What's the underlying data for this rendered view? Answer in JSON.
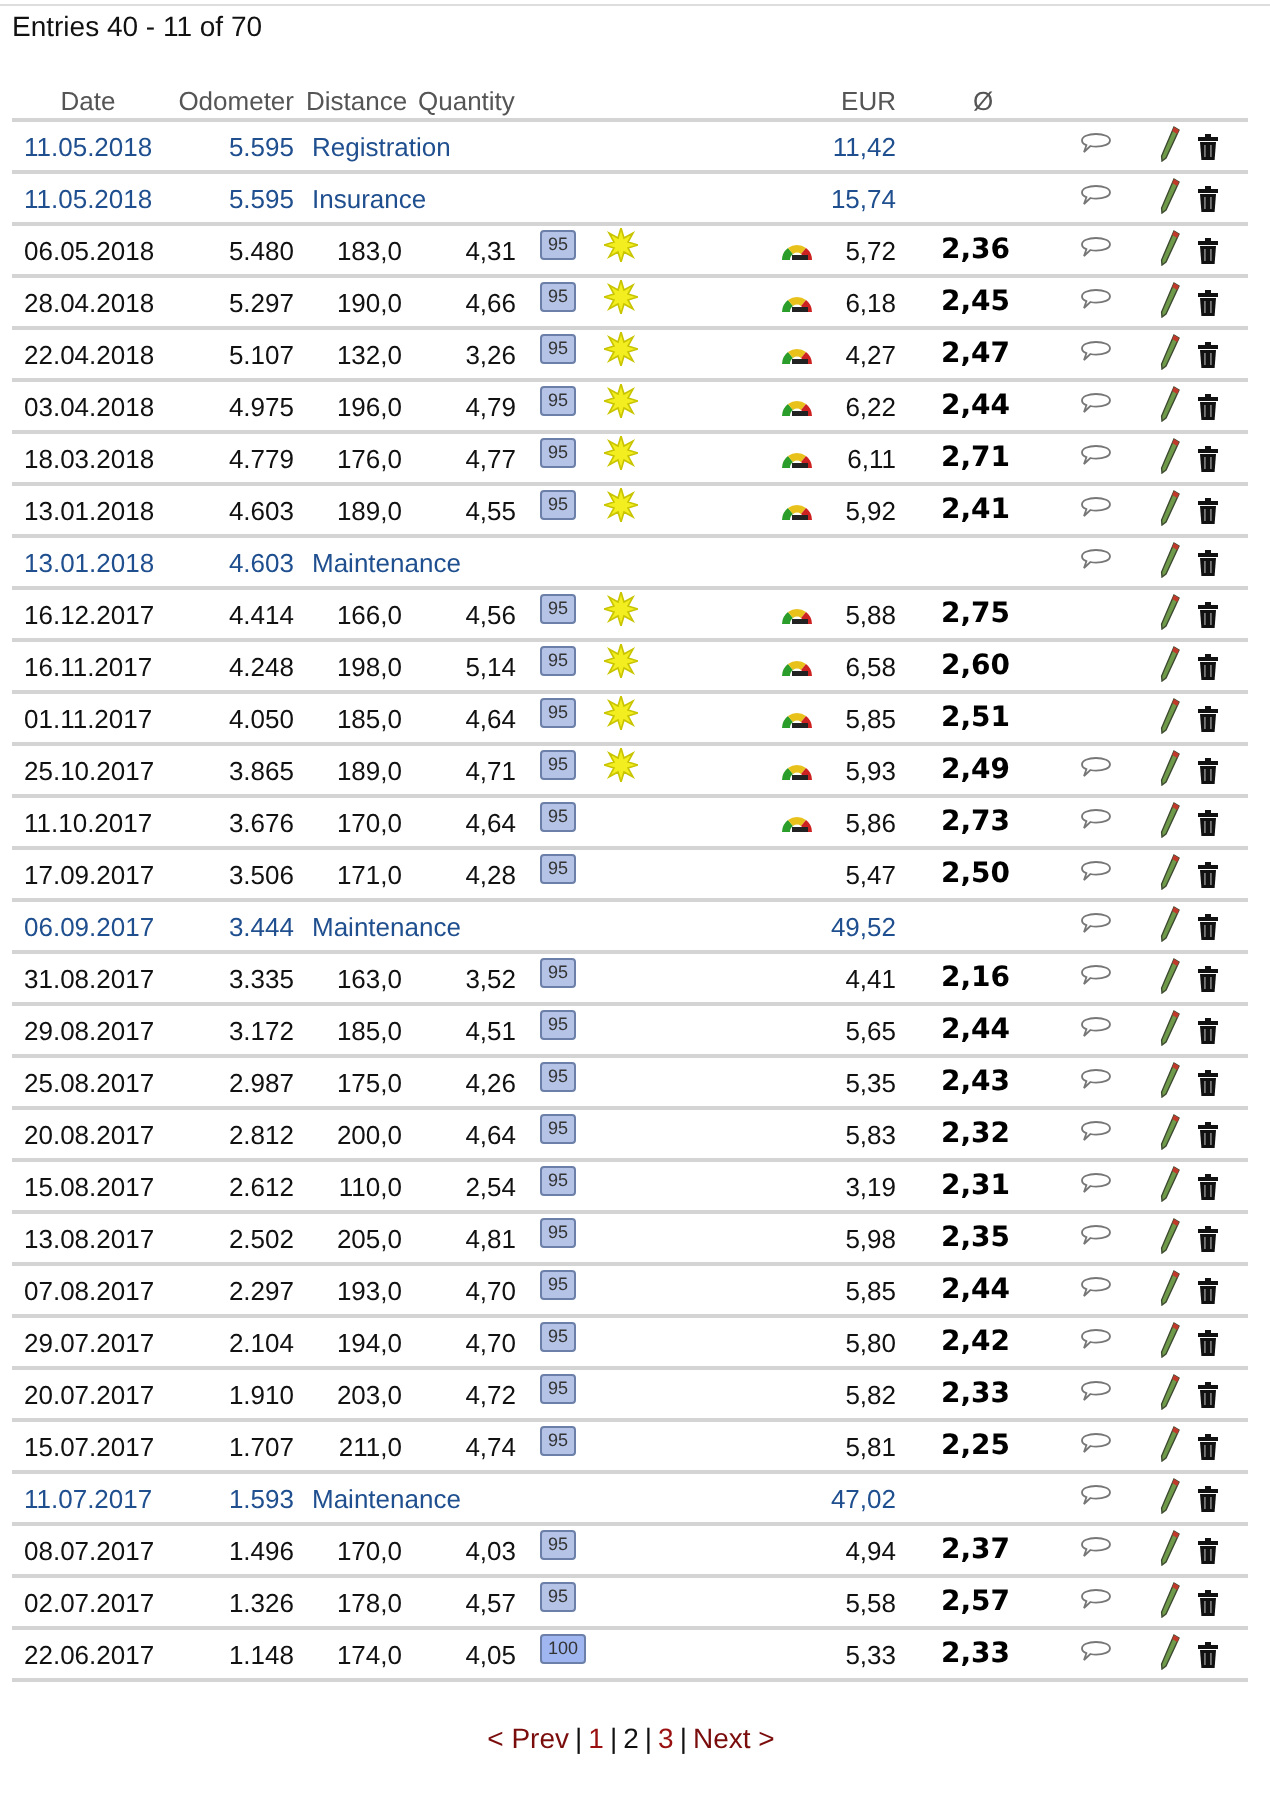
{
  "summary": "Entries 40 - 11 of 70",
  "columns": {
    "date": "Date",
    "odometer": "Odometer",
    "distance": "Distance",
    "quantity": "Quantity",
    "eur": "EUR",
    "average": "Ø"
  },
  "rows": [
    {
      "kind": "expense",
      "date": "11.05.2018",
      "odometer": "5.595",
      "description": "Registration",
      "eur": "11,42",
      "comment": true
    },
    {
      "kind": "expense",
      "date": "11.05.2018",
      "odometer": "5.595",
      "description": "Insurance",
      "eur": "15,74",
      "comment": true
    },
    {
      "kind": "fuel",
      "date": "06.05.2018",
      "odometer": "5.480",
      "distance": "183,0",
      "quantity": "4,31",
      "grade": "95",
      "sun": true,
      "gauge": true,
      "eur": "5,72",
      "average": "2,36",
      "comment": true
    },
    {
      "kind": "fuel",
      "date": "28.04.2018",
      "odometer": "5.297",
      "distance": "190,0",
      "quantity": "4,66",
      "grade": "95",
      "sun": true,
      "gauge": true,
      "eur": "6,18",
      "average": "2,45",
      "comment": true
    },
    {
      "kind": "fuel",
      "date": "22.04.2018",
      "odometer": "5.107",
      "distance": "132,0",
      "quantity": "3,26",
      "grade": "95",
      "sun": true,
      "gauge": true,
      "eur": "4,27",
      "average": "2,47",
      "comment": true
    },
    {
      "kind": "fuel",
      "date": "03.04.2018",
      "odometer": "4.975",
      "distance": "196,0",
      "quantity": "4,79",
      "grade": "95",
      "sun": true,
      "gauge": true,
      "eur": "6,22",
      "average": "2,44",
      "comment": true
    },
    {
      "kind": "fuel",
      "date": "18.03.2018",
      "odometer": "4.779",
      "distance": "176,0",
      "quantity": "4,77",
      "grade": "95",
      "sun": true,
      "gauge": true,
      "eur": "6,11",
      "average": "2,71",
      "comment": true
    },
    {
      "kind": "fuel",
      "date": "13.01.2018",
      "odometer": "4.603",
      "distance": "189,0",
      "quantity": "4,55",
      "grade": "95",
      "sun": true,
      "gauge": true,
      "eur": "5,92",
      "average": "2,41",
      "comment": true
    },
    {
      "kind": "expense",
      "date": "13.01.2018",
      "odometer": "4.603",
      "description": "Maintenance",
      "comment": true
    },
    {
      "kind": "fuel",
      "date": "16.12.2017",
      "odometer": "4.414",
      "distance": "166,0",
      "quantity": "4,56",
      "grade": "95",
      "sun": true,
      "gauge": true,
      "eur": "5,88",
      "average": "2,75",
      "comment": false
    },
    {
      "kind": "fuel",
      "date": "16.11.2017",
      "odometer": "4.248",
      "distance": "198,0",
      "quantity": "5,14",
      "grade": "95",
      "sun": true,
      "gauge": true,
      "eur": "6,58",
      "average": "2,60",
      "comment": false
    },
    {
      "kind": "fuel",
      "date": "01.11.2017",
      "odometer": "4.050",
      "distance": "185,0",
      "quantity": "4,64",
      "grade": "95",
      "sun": true,
      "gauge": true,
      "eur": "5,85",
      "average": "2,51",
      "comment": false
    },
    {
      "kind": "fuel",
      "date": "25.10.2017",
      "odometer": "3.865",
      "distance": "189,0",
      "quantity": "4,71",
      "grade": "95",
      "sun": true,
      "gauge": true,
      "eur": "5,93",
      "average": "2,49",
      "comment": true
    },
    {
      "kind": "fuel",
      "date": "11.10.2017",
      "odometer": "3.676",
      "distance": "170,0",
      "quantity": "4,64",
      "grade": "95",
      "sun": false,
      "gauge": true,
      "eur": "5,86",
      "average": "2,73",
      "comment": true
    },
    {
      "kind": "fuel",
      "date": "17.09.2017",
      "odometer": "3.506",
      "distance": "171,0",
      "quantity": "4,28",
      "grade": "95",
      "sun": false,
      "gauge": false,
      "eur": "5,47",
      "average": "2,50",
      "comment": true
    },
    {
      "kind": "expense",
      "date": "06.09.2017",
      "odometer": "3.444",
      "description": "Maintenance",
      "eur": "49,52",
      "comment": true
    },
    {
      "kind": "fuel",
      "date": "31.08.2017",
      "odometer": "3.335",
      "distance": "163,0",
      "quantity": "3,52",
      "grade": "95",
      "sun": false,
      "gauge": false,
      "eur": "4,41",
      "average": "2,16",
      "comment": true
    },
    {
      "kind": "fuel",
      "date": "29.08.2017",
      "odometer": "3.172",
      "distance": "185,0",
      "quantity": "4,51",
      "grade": "95",
      "sun": false,
      "gauge": false,
      "eur": "5,65",
      "average": "2,44",
      "comment": true
    },
    {
      "kind": "fuel",
      "date": "25.08.2017",
      "odometer": "2.987",
      "distance": "175,0",
      "quantity": "4,26",
      "grade": "95",
      "sun": false,
      "gauge": false,
      "eur": "5,35",
      "average": "2,43",
      "comment": true
    },
    {
      "kind": "fuel",
      "date": "20.08.2017",
      "odometer": "2.812",
      "distance": "200,0",
      "quantity": "4,64",
      "grade": "95",
      "sun": false,
      "gauge": false,
      "eur": "5,83",
      "average": "2,32",
      "comment": true
    },
    {
      "kind": "fuel",
      "date": "15.08.2017",
      "odometer": "2.612",
      "distance": "110,0",
      "quantity": "2,54",
      "grade": "95",
      "sun": false,
      "gauge": false,
      "eur": "3,19",
      "average": "2,31",
      "comment": true
    },
    {
      "kind": "fuel",
      "date": "13.08.2017",
      "odometer": "2.502",
      "distance": "205,0",
      "quantity": "4,81",
      "grade": "95",
      "sun": false,
      "gauge": false,
      "eur": "5,98",
      "average": "2,35",
      "comment": true
    },
    {
      "kind": "fuel",
      "date": "07.08.2017",
      "odometer": "2.297",
      "distance": "193,0",
      "quantity": "4,70",
      "grade": "95",
      "sun": false,
      "gauge": false,
      "eur": "5,85",
      "average": "2,44",
      "comment": true
    },
    {
      "kind": "fuel",
      "date": "29.07.2017",
      "odometer": "2.104",
      "distance": "194,0",
      "quantity": "4,70",
      "grade": "95",
      "sun": false,
      "gauge": false,
      "eur": "5,80",
      "average": "2,42",
      "comment": true
    },
    {
      "kind": "fuel",
      "date": "20.07.2017",
      "odometer": "1.910",
      "distance": "203,0",
      "quantity": "4,72",
      "grade": "95",
      "sun": false,
      "gauge": false,
      "eur": "5,82",
      "average": "2,33",
      "comment": true
    },
    {
      "kind": "fuel",
      "date": "15.07.2017",
      "odometer": "1.707",
      "distance": "211,0",
      "quantity": "4,74",
      "grade": "95",
      "sun": false,
      "gauge": false,
      "eur": "5,81",
      "average": "2,25",
      "comment": true
    },
    {
      "kind": "expense",
      "date": "11.07.2017",
      "odometer": "1.593",
      "description": "Maintenance",
      "eur": "47,02",
      "comment": true
    },
    {
      "kind": "fuel",
      "date": "08.07.2017",
      "odometer": "1.496",
      "distance": "170,0",
      "quantity": "4,03",
      "grade": "95",
      "sun": false,
      "gauge": false,
      "eur": "4,94",
      "average": "2,37",
      "comment": true
    },
    {
      "kind": "fuel",
      "date": "02.07.2017",
      "odometer": "1.326",
      "distance": "178,0",
      "quantity": "4,57",
      "grade": "95",
      "sun": false,
      "gauge": false,
      "eur": "5,58",
      "average": "2,57",
      "comment": true
    },
    {
      "kind": "fuel",
      "date": "22.06.2017",
      "odometer": "1.148",
      "distance": "174,0",
      "quantity": "4,05",
      "grade": "100",
      "sun": false,
      "gauge": false,
      "eur": "5,33",
      "average": "2,33",
      "comment": true
    }
  ],
  "pagination": [
    {
      "kind": "link",
      "label": "< Prev"
    },
    {
      "kind": "separator",
      "label": "|"
    },
    {
      "kind": "page",
      "label": "1",
      "selected": false
    },
    {
      "kind": "separator",
      "label": "|"
    },
    {
      "kind": "page",
      "label": "2",
      "selected": true
    },
    {
      "kind": "separator",
      "label": "|"
    },
    {
      "kind": "page",
      "label": "3",
      "selected": false
    },
    {
      "kind": "separator",
      "label": "|"
    },
    {
      "kind": "link",
      "label": "Next >"
    }
  ]
}
